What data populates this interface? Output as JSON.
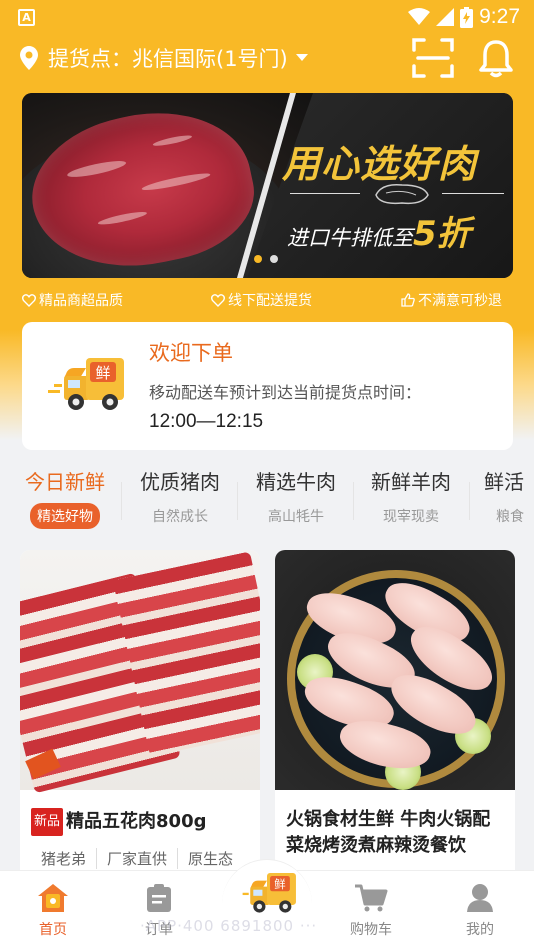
{
  "status_bar": {
    "time": "9:27",
    "app_badge": "A"
  },
  "header": {
    "pickup_label": "提货点：兆信国际(1号门)"
  },
  "banner": {
    "headline": "用心选好肉",
    "sub_prefix": "进口牛排低至",
    "sub_highlight": "5折",
    "slide_count": 2,
    "active_slide": 1
  },
  "features": [
    {
      "label": "精品商超品质",
      "icon": "heart-icon"
    },
    {
      "label": "线下配送提货",
      "icon": "heart-icon"
    },
    {
      "label": "不满意可秒退",
      "icon": "thumbs-up-icon"
    }
  ],
  "welcome": {
    "title": "欢迎下单",
    "truck_badge": "鲜",
    "description": "移动配送车预计到达当前提货点时间：",
    "time_range": "12:00—12:15"
  },
  "categories": [
    {
      "title": "今日新鲜",
      "subtitle": "精选好物",
      "active": true
    },
    {
      "title": "优质猪肉",
      "subtitle": "自然成长",
      "active": false
    },
    {
      "title": "精选牛肉",
      "subtitle": "高山牦牛",
      "active": false
    },
    {
      "title": "新鲜羊肉",
      "subtitle": "现宰现卖",
      "active": false
    },
    {
      "title": "鲜活",
      "subtitle": "粮食",
      "active": false
    }
  ],
  "products": [
    {
      "tag": "新品",
      "title": "精品五花肉800g",
      "tags": [
        "猪老弟",
        "厂家直供",
        "原生态"
      ]
    },
    {
      "tag": "",
      "title": "火锅食材生鲜 牛肉火锅配菜烧烤烫煮麻辣烫餐饮",
      "tags": []
    }
  ],
  "bottom_nav": {
    "items": [
      {
        "label": "首页",
        "icon": "home-icon",
        "active": true
      },
      {
        "label": "订单",
        "icon": "clipboard-icon",
        "active": false
      },
      {
        "label": "",
        "icon": "delivery-truck-icon",
        "active": false
      },
      {
        "label": "购物车",
        "icon": "cart-icon",
        "active": false
      },
      {
        "label": "我的",
        "icon": "user-icon",
        "active": false
      }
    ],
    "watermark": "·APP·400 6891800 ···"
  },
  "colors": {
    "brand_yellow": "#f9b926",
    "accent_orange": "#e96a1e",
    "tag_red": "#d8231f"
  }
}
